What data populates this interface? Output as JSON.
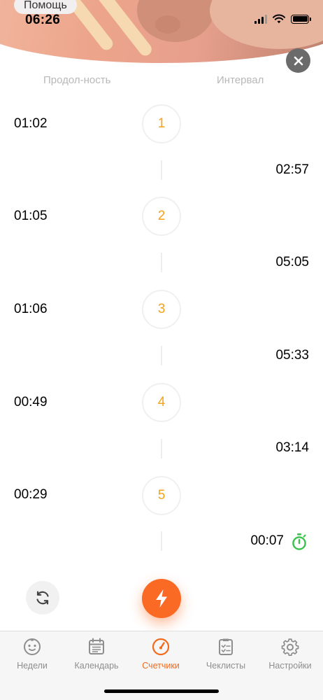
{
  "status_bar": {
    "time": "06:26",
    "help_label": "Помощь"
  },
  "header": {
    "close_icon": "close-icon"
  },
  "columns": {
    "duration_label": "Продол-ность",
    "interval_label": "Интервал"
  },
  "contractions": [
    {
      "number": "1",
      "duration": "01:02",
      "interval": "02:57"
    },
    {
      "number": "2",
      "duration": "01:05",
      "interval": "05:05"
    },
    {
      "number": "3",
      "duration": "01:06",
      "interval": "05:33"
    },
    {
      "number": "4",
      "duration": "00:49",
      "interval": "03:14"
    },
    {
      "number": "5",
      "duration": "00:29",
      "interval": "00:07"
    }
  ],
  "active_timer_icon": "stopwatch-icon",
  "colors": {
    "accent_orange": "#fa6a25",
    "number_orange": "#f7a21b",
    "timer_green": "#3cc24a",
    "tab_active": "#f26a1b",
    "tab_inactive": "#8e8e8e"
  },
  "controls": {
    "reset_icon": "refresh-icon",
    "start_icon": "lightning-icon"
  },
  "tabs": [
    {
      "label": "Недели",
      "icon": "baby-face-icon"
    },
    {
      "label": "Календарь",
      "icon": "calendar-icon"
    },
    {
      "label": "Счетчики",
      "icon": "counter-dial-icon",
      "active": true
    },
    {
      "label": "Чеклисты",
      "icon": "checklist-icon"
    },
    {
      "label": "Настройки",
      "icon": "gear-icon"
    }
  ]
}
